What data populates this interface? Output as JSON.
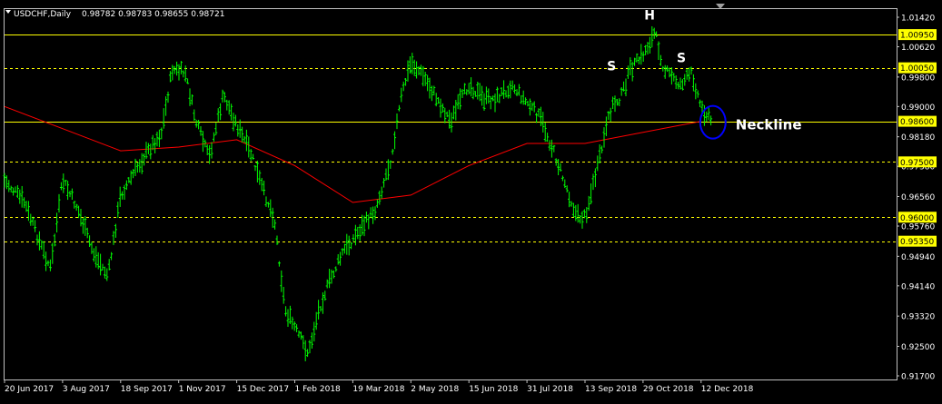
{
  "header": {
    "symbol_label": "USDCHF,Daily",
    "ohlc": "0.98782 0.98783 0.98655 0.98721"
  },
  "colors": {
    "background": "#000000",
    "frame": "#c0c0c0",
    "price": "#00ff00",
    "moving_average": "#ff0000",
    "level_line": "#ffff00",
    "level_label_bg": "#ffff00",
    "annotation_text": "#ffffff",
    "neckline_circle": "#0000ff"
  },
  "chart_data": {
    "type": "line",
    "ylim": [
      0.917,
      1.0142
    ],
    "y_ticks": [
      "1.01420",
      "1.00620",
      "0.99800",
      "0.99000",
      "0.98180",
      "0.97380",
      "0.96560",
      "0.95760",
      "0.94940",
      "0.94140",
      "0.93320",
      "0.92500",
      "0.91700"
    ],
    "x_ticks": [
      "20 Jun 2017",
      "3 Aug 2017",
      "18 Sep 2017",
      "1 Nov 2017",
      "15 Dec 2017",
      "1 Feb 2018",
      "19 Mar 2018",
      "2 May 2018",
      "15 Jun 2018",
      "31 Jul 2018",
      "13 Sep 2018",
      "29 Oct 2018",
      "12 Dec 2018"
    ],
    "levels": [
      {
        "label": "1.00950",
        "value": 1.0095,
        "style": "solid"
      },
      {
        "label": "1.00050",
        "value": 1.0005,
        "style": "dashed"
      },
      {
        "label": "0.98600",
        "value": 0.986,
        "style": "solid"
      },
      {
        "label": "0.97500",
        "value": 0.975,
        "style": "dashed"
      },
      {
        "label": "0.96000",
        "value": 0.96,
        "style": "dashed"
      },
      {
        "label": "0.95350",
        "value": 0.9535,
        "style": "dashed"
      }
    ],
    "series": [
      {
        "values": [
          [
            "20 Jun 2017",
            0.97
          ],
          [
            "5 Jul 2017",
            0.964
          ],
          [
            "18 Jul 2017",
            0.952
          ],
          [
            "25 Jul 2017",
            0.946
          ],
          [
            "3 Aug 2017",
            0.97
          ],
          [
            "14 Aug 2017",
            0.963
          ],
          [
            "28 Aug 2017",
            0.95
          ],
          [
            "8 Sep 2017",
            0.944
          ],
          [
            "18 Sep 2017",
            0.966
          ],
          [
            "5 Oct 2017",
            0.976
          ],
          [
            "19 Oct 2017",
            0.983
          ],
          [
            "27 Oct 2017",
            1.0
          ],
          [
            "6 Nov 2017",
            0.999
          ],
          [
            "14 Nov 2017",
            0.986
          ],
          [
            "24 Nov 2017",
            0.976
          ],
          [
            "5 Dec 2017",
            0.993
          ],
          [
            "15 Dec 2017",
            0.985
          ],
          [
            "27 Dec 2017",
            0.977
          ],
          [
            "5 Jan 2018",
            0.968
          ],
          [
            "15 Jan 2018",
            0.96
          ],
          [
            "24 Jan 2018",
            0.935
          ],
          [
            "1 Feb 2018",
            0.93
          ],
          [
            "12 Feb 2018",
            0.923
          ],
          [
            "20 Feb 2018",
            0.935
          ],
          [
            "1 Mar 2018",
            0.943
          ],
          [
            "12 Mar 2018",
            0.951
          ],
          [
            "19 Mar 2018",
            0.954
          ],
          [
            "5 Apr 2018",
            0.962
          ],
          [
            "17 Apr 2018",
            0.976
          ],
          [
            "25 Apr 2018",
            0.993
          ],
          [
            "2 May 2018",
            1.002
          ],
          [
            "10 May 2018",
            0.999
          ],
          [
            "22 May 2018",
            0.992
          ],
          [
            "1 Jun 2018",
            0.986
          ],
          [
            "15 Jun 2018",
            0.996
          ],
          [
            "27 Jun 2018",
            0.992
          ],
          [
            "6 Jul 2018",
            0.992
          ],
          [
            "19 Jul 2018",
            0.996
          ],
          [
            "31 Jul 2018",
            0.991
          ],
          [
            "10 Aug 2018",
            0.987
          ],
          [
            "20 Aug 2018",
            0.978
          ],
          [
            "30 Aug 2018",
            0.968
          ],
          [
            "7 Sep 2018",
            0.96
          ],
          [
            "13 Sep 2018",
            0.96
          ],
          [
            "24 Sep 2018",
            0.975
          ],
          [
            "4 Oct 2018",
            0.99
          ],
          [
            "12 Oct 2018",
            0.993
          ],
          [
            "19 Oct 2018",
            1.0
          ],
          [
            "29 Oct 2018",
            1.004
          ],
          [
            "7 Nov 2018",
            1.01
          ],
          [
            "14 Nov 2018",
            1.0
          ],
          [
            "26 Nov 2018",
            0.996
          ],
          [
            "5 Dec 2018",
            0.999
          ],
          [
            "12 Dec 2018",
            0.99
          ],
          [
            "20 Dec 2018",
            0.986
          ]
        ]
      },
      {
        "values": [
          [
            "20 Jun 2017",
            0.99
          ],
          [
            "3 Aug 2017",
            0.984
          ],
          [
            "18 Sep 2017",
            0.978
          ],
          [
            "1 Nov 2017",
            0.979
          ],
          [
            "15 Dec 2017",
            0.981
          ],
          [
            "1 Feb 2018",
            0.974
          ],
          [
            "19 Mar 2018",
            0.964
          ],
          [
            "2 May 2018",
            0.966
          ],
          [
            "15 Jun 2018",
            0.974
          ],
          [
            "31 Jul 2018",
            0.98
          ],
          [
            "13 Sep 2018",
            0.98
          ],
          [
            "29 Oct 2018",
            0.983
          ],
          [
            "12 Dec 2018",
            0.986
          ]
        ]
      }
    ],
    "annotations": [
      {
        "text": "S",
        "date": "4 Oct 2018",
        "value": 0.9998
      },
      {
        "text": "H",
        "date": "3 Nov 2018",
        "value": 1.0136
      },
      {
        "text": "S",
        "date": "27 Nov 2018",
        "value": 1.002
      },
      {
        "text": "Neckline",
        "date": "12 Dec 2018",
        "value": 0.985
      }
    ]
  }
}
